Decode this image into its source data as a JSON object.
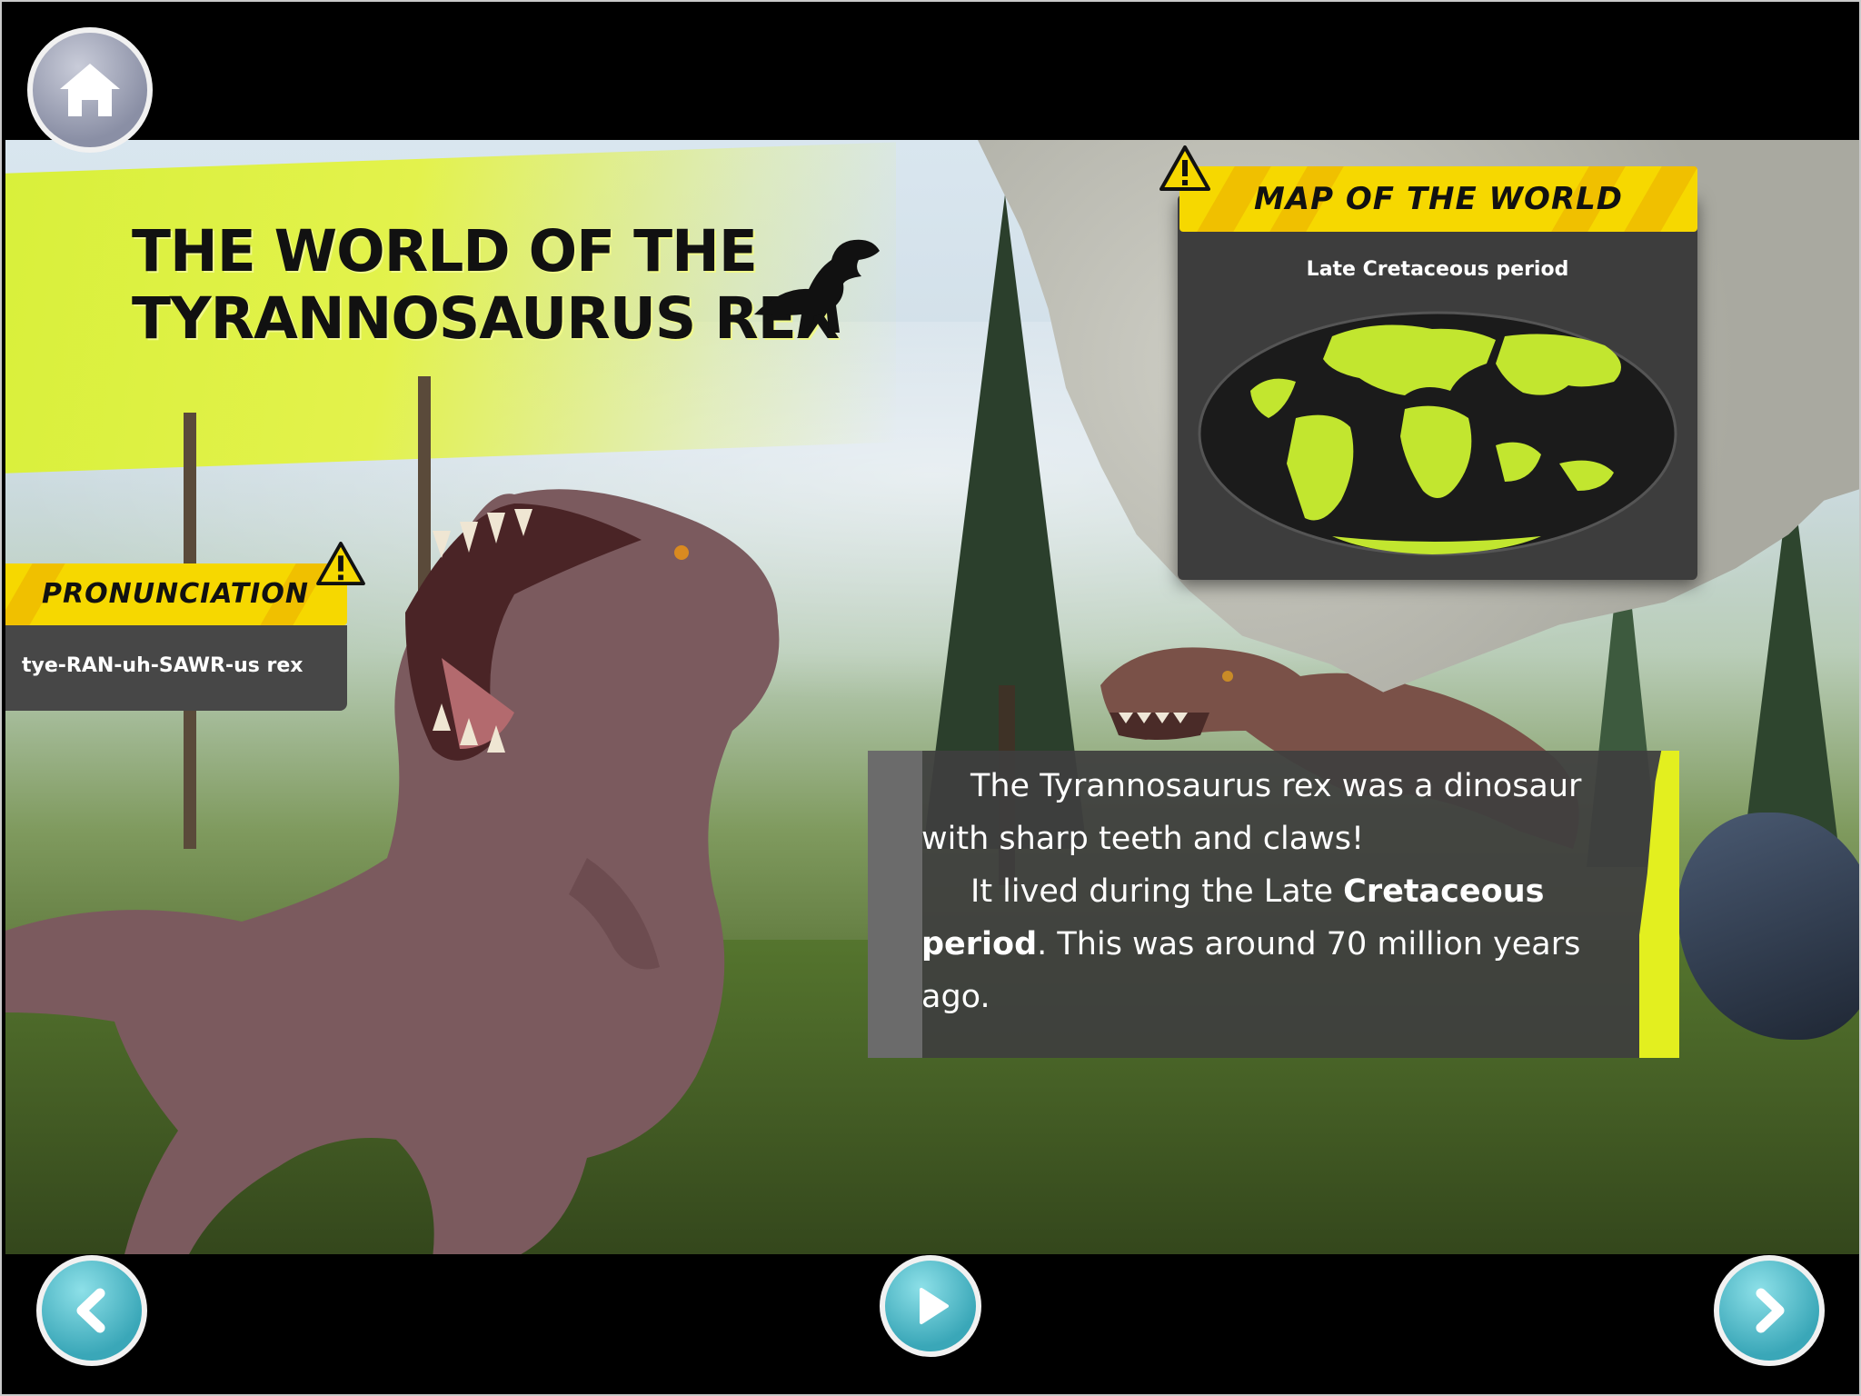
{
  "page": {
    "title_line1": "THE WORLD OF THE",
    "title_line2": "TYRANNOSAURUS REX"
  },
  "pronunciation": {
    "label": "PRONUNCIATION",
    "text": "tye-RAN-uh-SAWR-us rex"
  },
  "map": {
    "label": "MAP OF THE WORLD",
    "subtitle": "Late Cretaceous period"
  },
  "story": {
    "line1": "The Tyrannosaurus rex was a dinosaur with sharp teeth and claws!",
    "line2_pre": "It lived during the Late ",
    "line2_bold": "Cretaceous period",
    "line2_post": ". This was around 70 million years ago."
  },
  "controls": {
    "home_icon": "home-icon",
    "prev_icon": "chevron-left-icon",
    "play_icon": "play-icon",
    "next_icon": "chevron-right-icon"
  },
  "colors": {
    "accent_yellow": "#f6d800",
    "lime": "#d8f03a",
    "nav_teal": "#3aa7b8"
  }
}
